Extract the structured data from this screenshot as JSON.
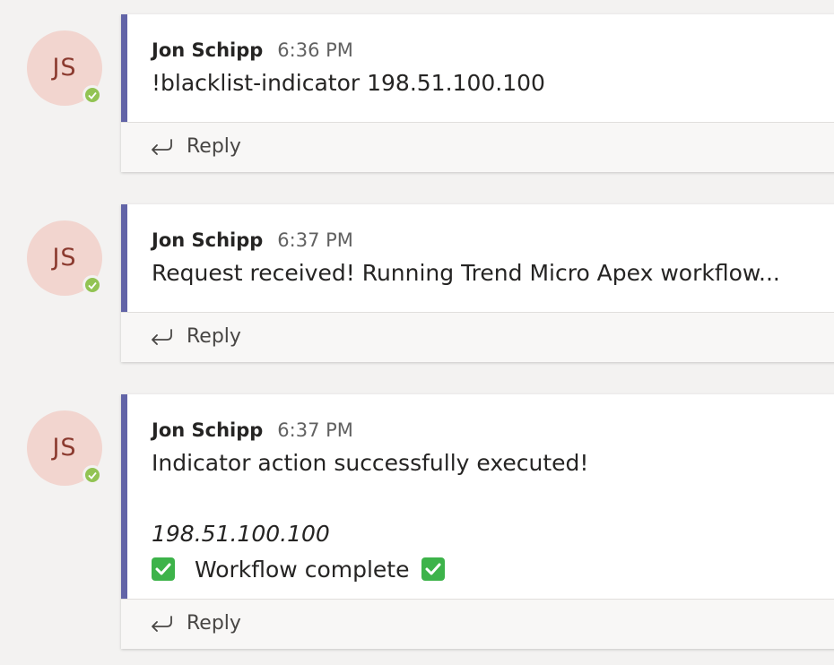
{
  "messages": [
    {
      "author": "Jon Schipp",
      "initials": "JS",
      "time": "6:36 PM",
      "lines": [
        "!blacklist-indicator 198.51.100.100"
      ],
      "reply_label": "Reply"
    },
    {
      "author": "Jon Schipp",
      "initials": "JS",
      "time": "6:37 PM",
      "lines": [
        "Request received! Running Trend Micro Apex workflow..."
      ],
      "reply_label": "Reply"
    },
    {
      "author": "Jon Schipp",
      "initials": "JS",
      "time": "6:37 PM",
      "lines": [
        "Indicator action successfully executed!",
        "198.51.100.100",
        "Workflow complete"
      ],
      "reply_label": "Reply"
    }
  ],
  "colors": {
    "accent": "#6264a7",
    "avatar_bg": "#f2d5cf",
    "avatar_text": "#8b3a2f",
    "presence_available": "#92c353",
    "check_green": "#3db34a"
  },
  "icons": {
    "presence": "available-check-icon",
    "reply": "reply-arrow-icon",
    "check": "white-check-mark-emoji"
  }
}
